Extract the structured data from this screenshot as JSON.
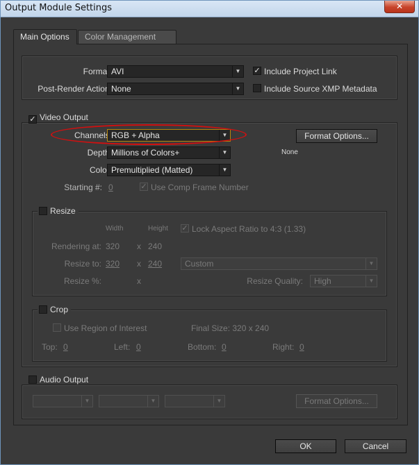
{
  "window": {
    "title": "Output Module Settings",
    "close_glyph": "✕"
  },
  "tabs": [
    {
      "label": "Main Options",
      "active": true
    },
    {
      "label": "Color Management",
      "active": false
    }
  ],
  "format_group": {
    "format_label": "Format:",
    "format_value": "AVI",
    "post_render_label": "Post-Render Action:",
    "post_render_value": "None",
    "include_project_link": {
      "label": "Include Project Link",
      "checked": true
    },
    "include_xmp": {
      "label": "Include Source XMP Metadata",
      "checked": false
    }
  },
  "video_output": {
    "label": "Video Output",
    "checked": true,
    "channels_label": "Channels:",
    "channels_value": "RGB + Alpha",
    "depth_label": "Depth:",
    "depth_value": "Millions of Colors+",
    "color_label": "Color:",
    "color_value": "Premultiplied (Matted)",
    "format_options_button": "Format Options...",
    "codec_text": "None",
    "starting_label": "Starting #:",
    "starting_value": "0",
    "use_comp_frame": {
      "label": "Use Comp Frame Number",
      "checked": true
    },
    "resize": {
      "label": "Resize",
      "checked": false,
      "width_header": "Width",
      "height_header": "Height",
      "lock_aspect": {
        "label": "Lock Aspect Ratio to 4:3 (1.33)",
        "checked": true
      },
      "rendering_at_label": "Rendering at:",
      "rendering_at_w": "320",
      "rendering_at_h": "240",
      "resize_to_label": "Resize to:",
      "resize_to_w": "320",
      "resize_to_h": "240",
      "resize_to_preset": "Custom",
      "resize_pct_label": "Resize %:",
      "x_sep": "x",
      "resize_quality_label": "Resize Quality:",
      "resize_quality_value": "High"
    },
    "crop": {
      "label": "Crop",
      "checked": false,
      "use_roi": {
        "label": "Use Region of Interest",
        "checked": false
      },
      "final_size": "Final Size: 320 x 240",
      "top_label": "Top:",
      "top_value": "0",
      "left_label": "Left:",
      "left_value": "0",
      "bottom_label": "Bottom:",
      "bottom_value": "0",
      "right_label": "Right:",
      "right_value": "0"
    }
  },
  "audio_output": {
    "label": "Audio Output",
    "checked": false,
    "format_options_button": "Format Options..."
  },
  "footer": {
    "ok_label": "OK",
    "cancel_label": "Cancel"
  },
  "icons": {
    "dropdown_arrow": "▼",
    "check_mark": "✓"
  },
  "colors": {
    "panel_bg": "#3a3a3a",
    "field_bg": "#262626",
    "annotation_red": "#d01010",
    "highlight_border": "#b8860b"
  }
}
